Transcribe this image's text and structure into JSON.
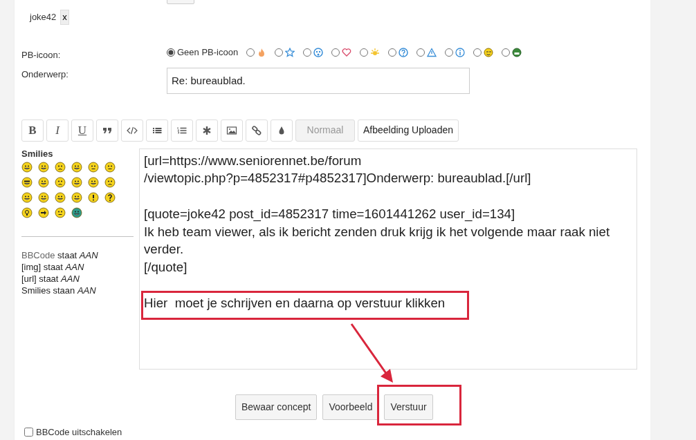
{
  "recipient": {
    "name": "joke42",
    "remove": "x"
  },
  "pb_icon": {
    "label": "PB-icoon:",
    "options": [
      {
        "label": "Geen PB-icoon",
        "selected": true
      },
      {
        "selected": false
      },
      {
        "selected": false
      },
      {
        "selected": false
      },
      {
        "selected": false
      },
      {
        "selected": false
      },
      {
        "selected": false
      },
      {
        "selected": false
      },
      {
        "selected": false
      },
      {
        "selected": false
      },
      {
        "selected": false
      }
    ]
  },
  "subject": {
    "label": "Onderwerp:",
    "value": "Re: bureaublad."
  },
  "toolbar": [
    {
      "kind": "glyph",
      "label": "B"
    },
    {
      "kind": "glyph",
      "label": "I"
    },
    {
      "kind": "glyph",
      "label": "U"
    },
    {
      "kind": "icon"
    },
    {
      "kind": "icon"
    },
    {
      "kind": "icon"
    },
    {
      "kind": "icon"
    },
    {
      "kind": "icon"
    },
    {
      "kind": "icon"
    },
    {
      "kind": "icon"
    },
    {
      "kind": "icon"
    },
    {
      "kind": "select",
      "label": "Normaal",
      "disabled": true
    },
    {
      "kind": "button",
      "label": "Afbeelding Uploaden"
    }
  ],
  "smilies": {
    "title": "Smilies"
  },
  "settings": [
    {
      "link": "BBCode",
      "text": " staat *AAN*"
    },
    {
      "text": "[img] staat *AAN*"
    },
    {
      "text": "[url] staat *AAN*"
    },
    {
      "text": "Smilies staan *AAN*"
    }
  ],
  "message": {
    "paragraphs": [
      [
        "[url=https://www.seniorennet.be/forum",
        "/viewtopic.php?p=4852317#p4852317]Onderwerp: bureaublad.[/url]"
      ],
      [
        "[quote=joke42 post_id=4852317 time=1601441262 user_id=134]",
        "Ik heb team viewer, als ik bericht zenden druk krijg ik het volgende maar raak niet verder.",
        "[/quote]"
      ],
      [
        "Hier  moet je schrijven en daarna op verstuur klikken"
      ]
    ]
  },
  "buttons": [
    "Bewaar concept",
    "Voorbeeld",
    "Verstuur"
  ],
  "options": [
    {
      "label": "BBCode uitschakelen",
      "checked": false
    }
  ]
}
